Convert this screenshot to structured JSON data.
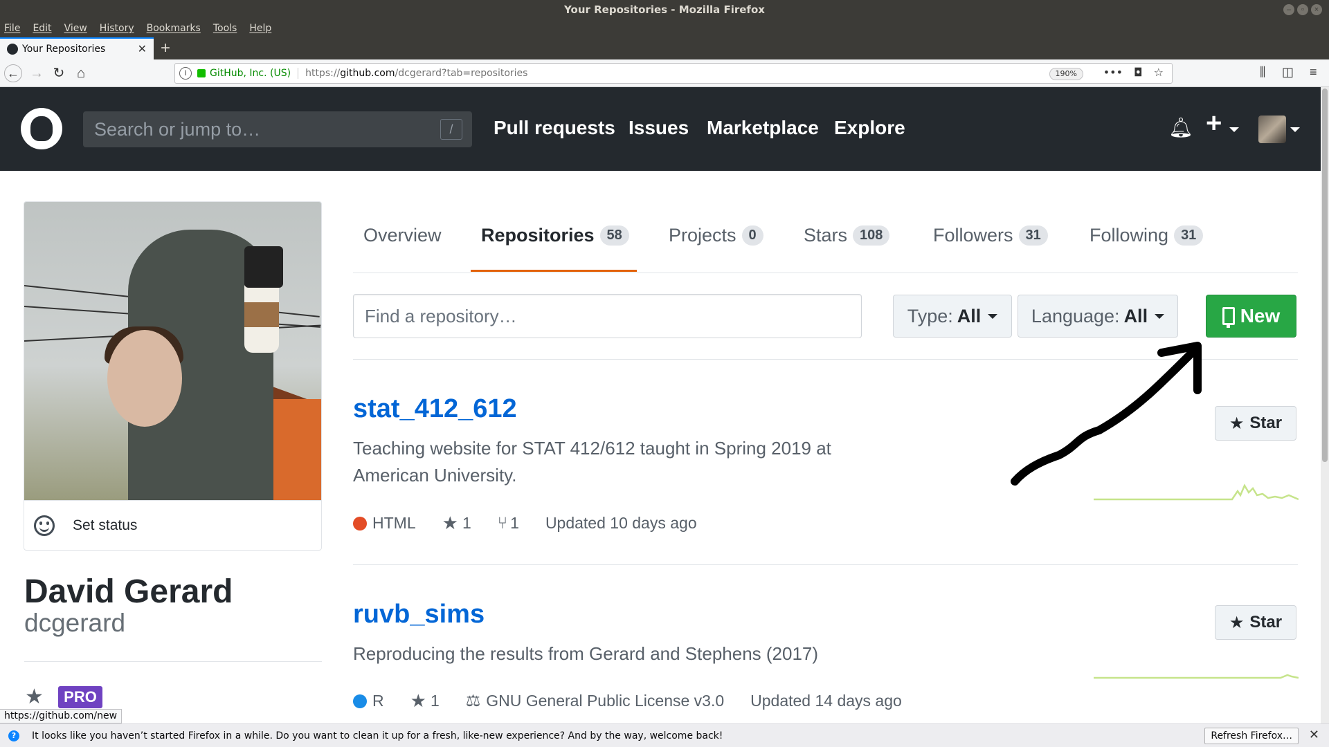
{
  "window": {
    "title": "Your Repositories - Mozilla Firefox",
    "menu": [
      "File",
      "Edit",
      "View",
      "History",
      "Bookmarks",
      "Tools",
      "Help"
    ]
  },
  "browser": {
    "tab_title": "Your Repositories",
    "site_identity": "GitHub, Inc. (US)",
    "url_prefix": "https://",
    "url_host": "github.com",
    "url_path": "/dcgerard?tab=repositories",
    "zoom": "190%",
    "status_url": "https://github.com/new"
  },
  "github_header": {
    "search_placeholder": "Search or jump to…",
    "search_hotkey": "/",
    "nav": [
      "Pull requests",
      "Issues",
      "Marketplace",
      "Explore"
    ]
  },
  "profile": {
    "set_status": "Set status",
    "full_name": "David Gerard",
    "username": "dcgerard",
    "badge": "PRO"
  },
  "tabs": [
    {
      "label": "Overview",
      "count": ""
    },
    {
      "label": "Repositories",
      "count": "58"
    },
    {
      "label": "Projects",
      "count": "0"
    },
    {
      "label": "Stars",
      "count": "108"
    },
    {
      "label": "Followers",
      "count": "31"
    },
    {
      "label": "Following",
      "count": "31"
    }
  ],
  "filters": {
    "find_placeholder": "Find a repository…",
    "type_label": "Type:",
    "type_value": "All",
    "language_label": "Language:",
    "language_value": "All",
    "new_label": "New"
  },
  "repos": [
    {
      "name": "stat_412_612",
      "description": "Teaching website for STAT 412/612 taught in Spring 2019 at American University.",
      "language": "HTML",
      "language_color": "#e34c26",
      "stars": "1",
      "forks": "1",
      "license": "",
      "updated": "Updated 10 days ago",
      "star_label": "Star"
    },
    {
      "name": "ruvb_sims",
      "description": "Reproducing the results from Gerard and Stephens (2017)",
      "language": "R",
      "language_color": "#198ce7",
      "stars": "1",
      "forks": "",
      "license": "GNU General Public License v3.0",
      "updated": "Updated 14 days ago",
      "star_label": "Star"
    }
  ],
  "notification": {
    "message": "It looks like you haven’t started Firefox in a while. Do you want to clean it up for a fresh, like-new experience? And by the way, welcome back!",
    "button": "Refresh Firefox…"
  },
  "colors": {
    "header_bg": "#24292e",
    "link": "#0366d6",
    "accent_tab": "#e36209",
    "new_button": "#28a745",
    "pro_badge": "#6f42c1"
  }
}
